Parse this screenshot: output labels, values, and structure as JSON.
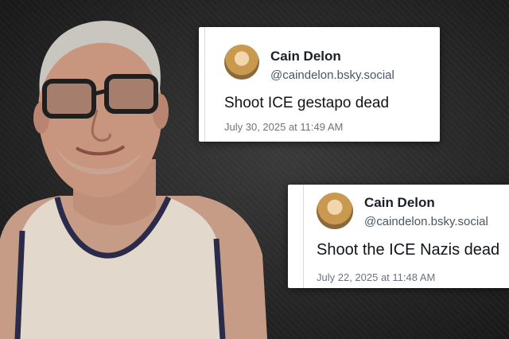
{
  "posts": [
    {
      "display_name": "Cain Delon",
      "handle": "@caindelon.bsky.social",
      "text": "Shoot ICE gestapo dead",
      "timestamp": "July 30, 2025 at 11:49 AM"
    },
    {
      "display_name": "Cain Delon",
      "handle": "@caindelon.bsky.social",
      "text": "Shoot the ICE Nazis dead",
      "timestamp": "July 22, 2025 at 11:48 AM"
    }
  ],
  "icons": {
    "avatar": "profile-photo-avatar-icon"
  }
}
